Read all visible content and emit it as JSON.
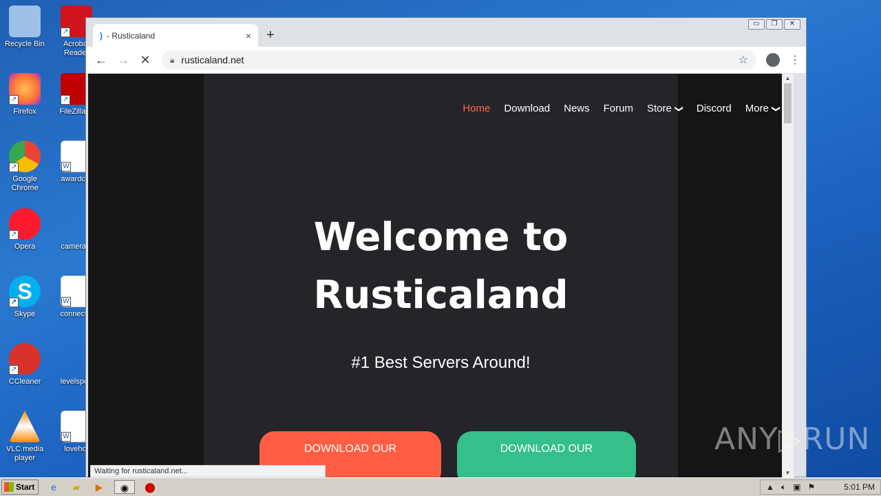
{
  "desktop": {
    "icons": [
      {
        "label": "Recycle Bin",
        "icon": "recycle-bin-icon",
        "color": "#7fa8d8"
      },
      {
        "label": "Acrobat Reader",
        "icon": "acrobat-icon",
        "color": "#d0131d"
      },
      {
        "label": "Firefox",
        "icon": "firefox-icon",
        "color": "#ff7139"
      },
      {
        "label": "FileZilla C",
        "icon": "filezilla-icon",
        "color": "#bf0000"
      },
      {
        "label": "Google Chrome",
        "icon": "chrome-icon",
        "color": "#4285f4"
      },
      {
        "label": "awardcer",
        "icon": "word-doc-icon",
        "color": "#2b579a"
      },
      {
        "label": "Opera",
        "icon": "opera-icon",
        "color": "#ff1b2d"
      },
      {
        "label": "camerast",
        "icon": "blank-doc-icon",
        "color": "#1f5fb4"
      },
      {
        "label": "Skype",
        "icon": "skype-icon",
        "color": "#00aff0"
      },
      {
        "label": "connectio",
        "icon": "word-doc-icon",
        "color": "#2b579a"
      },
      {
        "label": "CCleaner",
        "icon": "ccleaner-icon",
        "color": "#d9322b"
      },
      {
        "label": "levelspop",
        "icon": "blank-doc-icon",
        "color": "#1f5fb4"
      },
      {
        "label": "VLC media player",
        "icon": "vlc-icon",
        "color": "#ff8800"
      },
      {
        "label": "lovehot",
        "icon": "word-doc-icon",
        "color": "#2b579a"
      }
    ]
  },
  "browser": {
    "tab": {
      "title": "- Rusticaland",
      "spinner": ")",
      "close": "×"
    },
    "new_tab": "+",
    "window_buttons": [
      "▭",
      "❐",
      "✕"
    ],
    "nav": {
      "back": "←",
      "forward": "→",
      "stop": "✕"
    },
    "url": "rusticaland.net",
    "status": "Waiting for rusticaland.net..."
  },
  "site": {
    "nav": [
      "Home",
      "Download",
      "News",
      "Forum",
      "Store",
      "Discord",
      "More"
    ],
    "hero_line1": "Welcome to",
    "hero_line2": "Rusticaland",
    "subtitle": "#1 Best Servers Around!",
    "cta_left": "DOWNLOAD OUR",
    "cta_right": "DOWNLOAD OUR",
    "accent": "#ff6b4f"
  },
  "watermark": "ANY▷RUN",
  "taskbar": {
    "start": "Start",
    "clock": "5:01 PM"
  }
}
